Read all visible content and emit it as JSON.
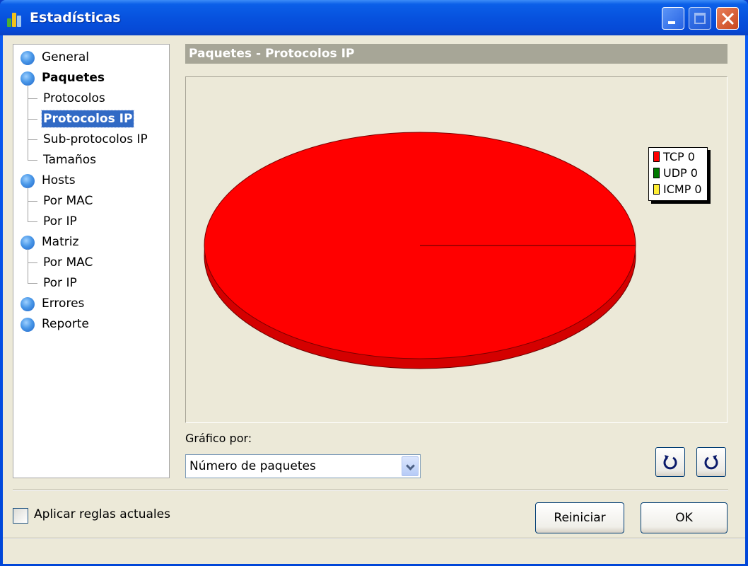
{
  "window": {
    "title": "Estadísticas",
    "icons": {
      "app": "bar-chart-icon",
      "minimize": "minimize-icon",
      "maximize": "maximize-icon",
      "close": "close-icon"
    }
  },
  "sidebar": {
    "items": [
      {
        "label": "General",
        "level": 0,
        "bold": false,
        "selected": false
      },
      {
        "label": "Paquetes",
        "level": 0,
        "bold": true,
        "selected": false
      },
      {
        "label": "Protocolos",
        "level": 1,
        "bold": false,
        "selected": false
      },
      {
        "label": "Protocolos IP",
        "level": 1,
        "bold": false,
        "selected": true
      },
      {
        "label": "Sub-protocolos IP",
        "level": 1,
        "bold": false,
        "selected": false
      },
      {
        "label": "Tamaños",
        "level": 1,
        "bold": false,
        "selected": false
      },
      {
        "label": "Hosts",
        "level": 0,
        "bold": false,
        "selected": false
      },
      {
        "label": "Por MAC",
        "level": 1,
        "bold": false,
        "selected": false
      },
      {
        "label": "Por IP",
        "level": 1,
        "bold": false,
        "selected": false
      },
      {
        "label": "Matriz",
        "level": 0,
        "bold": false,
        "selected": false
      },
      {
        "label": "Por MAC",
        "level": 1,
        "bold": false,
        "selected": false
      },
      {
        "label": "Por IP",
        "level": 1,
        "bold": false,
        "selected": false
      },
      {
        "label": "Errores",
        "level": 0,
        "bold": false,
        "selected": false
      },
      {
        "label": "Reporte",
        "level": 0,
        "bold": false,
        "selected": false
      }
    ]
  },
  "main": {
    "header": "Paquetes - Protocolos IP",
    "graph_by_label": "Gráfico por:",
    "graph_by_value": "Número de paquetes",
    "rotate_buttons": [
      {
        "icon": "rotate-clockwise-icon"
      },
      {
        "icon": "rotate-counterclockwise-icon"
      }
    ]
  },
  "chart_data": {
    "type": "pie",
    "style": "3d",
    "title": "Paquetes - Protocolos IP",
    "categories": [
      "TCP",
      "UDP",
      "ICMP"
    ],
    "values": [
      0,
      0,
      0
    ],
    "colors": [
      "#ff0000",
      "#007a00",
      "#ffee33"
    ],
    "legend": [
      {
        "label": "TCP 0",
        "color": "#ff0000"
      },
      {
        "label": "UDP 0",
        "color": "#007a00"
      },
      {
        "label": "ICMP 0",
        "color": "#ffee33"
      }
    ],
    "legend_position": "top-right",
    "note": "All values are 0; pie is rendered as a single full red disc"
  },
  "footer": {
    "checkbox_label": "Aplicar reglas actuales",
    "checkbox_checked": false,
    "reset_label": "Reiniciar",
    "ok_label": "OK"
  }
}
